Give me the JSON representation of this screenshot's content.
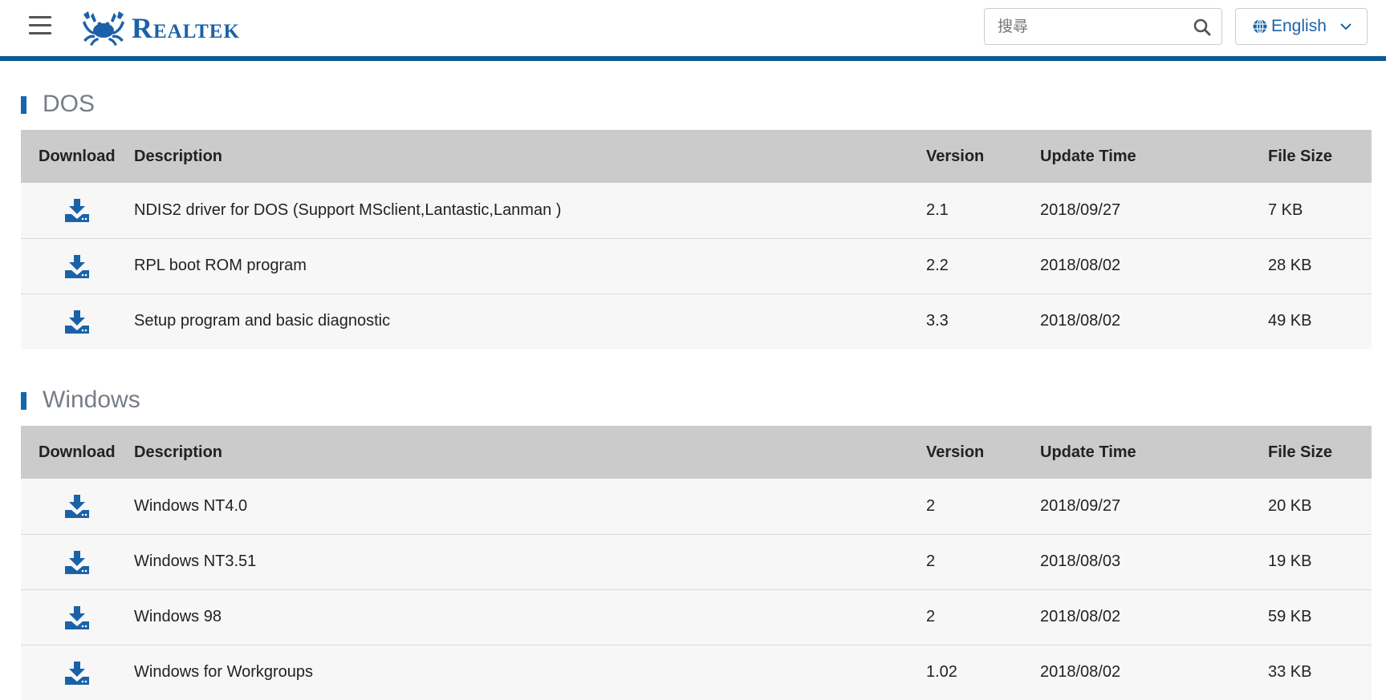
{
  "header": {
    "logo_text": "Realtek",
    "search_placeholder": "搜尋",
    "language": "English"
  },
  "columns": [
    "Download",
    "Description",
    "Version",
    "Update Time",
    "File Size"
  ],
  "sections": [
    {
      "title": "DOS",
      "rows": [
        {
          "description": "NDIS2 driver for DOS (Support MSclient,Lantastic,Lanman )",
          "version": "2.1",
          "update_time": "2018/09/27",
          "file_size": "7 KB"
        },
        {
          "description": "RPL boot ROM program",
          "version": "2.2",
          "update_time": "2018/08/02",
          "file_size": "28 KB"
        },
        {
          "description": "Setup program and basic diagnostic",
          "version": "3.3",
          "update_time": "2018/08/02",
          "file_size": "49 KB"
        }
      ]
    },
    {
      "title": "Windows",
      "rows": [
        {
          "description": "Windows NT4.0",
          "version": "2",
          "update_time": "2018/09/27",
          "file_size": "20 KB"
        },
        {
          "description": "Windows NT3.51",
          "version": "2",
          "update_time": "2018/08/03",
          "file_size": "19 KB"
        },
        {
          "description": "Windows 98",
          "version": "2",
          "update_time": "2018/08/02",
          "file_size": "59 KB"
        },
        {
          "description": "Windows for Workgroups",
          "version": "1.02",
          "update_time": "2018/08/02",
          "file_size": "33 KB"
        }
      ]
    }
  ],
  "colors": {
    "brand": "#1a62a8",
    "header_rule": "#0b5a92",
    "table_header_bg": "#cbcbcb",
    "row_bg": "#f7f7f7"
  }
}
